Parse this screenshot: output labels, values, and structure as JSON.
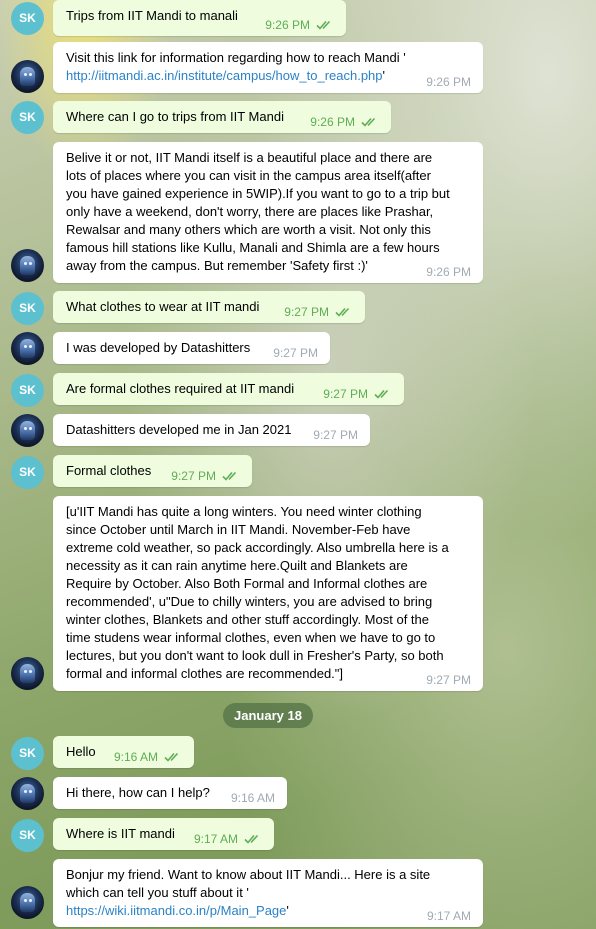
{
  "colors": {
    "outgoing_bubble": "#effdde",
    "incoming_bubble": "#ffffff",
    "outgoing_time": "#5fad56",
    "incoming_time": "#a1aab3",
    "link": "#2a82c8",
    "avatar_sk": "#5cc0cf"
  },
  "user_avatar_initials": "SK",
  "date_separator": "January 18",
  "messages": [
    {
      "from": "user",
      "text": "Trips from IIT Mandi to manali",
      "time": "9:26 PM",
      "read": true
    },
    {
      "from": "bot",
      "text": "Visit this link for  information regarding how to reach Mandi '",
      "link": "http://iitmandi.ac.in/institute/campus/how_to_reach.php",
      "after_link": "'",
      "time": "9:26 PM"
    },
    {
      "from": "user",
      "text": "Where can I go to trips from IIT Mandi",
      "time": "9:26 PM",
      "read": true
    },
    {
      "from": "bot",
      "lines": [
        "Belive it or not, IIT Mandi itself is a beautiful place and there are",
        "lots of places where you can visit in the campus area itself(after",
        "you have gained experience in 5WIP).If you want to go to a trip but",
        "only have a weekend, don't worry, there are places like Prashar,",
        "Rewalsar and many others which are worth a visit. Not only this",
        "famous hill stations like Kullu, Manali and Shimla are a few hours",
        "away from the campus. But remember 'Safety first :)'"
      ],
      "time": "9:26 PM"
    },
    {
      "from": "user",
      "text": "What clothes to wear at IIT mandi",
      "time": "9:27 PM",
      "read": true
    },
    {
      "from": "bot",
      "text": "I was developed by Datashitters",
      "time": "9:27 PM"
    },
    {
      "from": "user",
      "text": "Are formal clothes required at IIT mandi",
      "time": "9:27 PM",
      "read": true
    },
    {
      "from": "bot",
      "text": "Datashitters developed me in Jan 2021",
      "time": "9:27 PM"
    },
    {
      "from": "user",
      "text": "Formal clothes",
      "time": "9:27 PM",
      "read": true
    },
    {
      "from": "bot",
      "lines": [
        "[u'IIT Mandi has quite a long winters. You need winter clothing",
        "since October until March in IIT Mandi. November-Feb have",
        "extreme cold weather, so pack accordingly. Also umbrella here is a",
        "necessity as it can rain anytime here.Quilt and Blankets are",
        "Require by October. Also Both Formal and Informal clothes are",
        "recommended', u\"Due to chilly winters, you are advised to bring",
        "winter clothes, Blankets and other stuff accordingly. Most of the",
        "time studens wear informal clothes, even when we have to go to",
        "lectures, but you don't want to look dull in Fresher's Party, so both",
        "formal and informal clothes are recommended.\"]"
      ],
      "time": "9:27 PM"
    },
    {
      "from": "user",
      "text": "Hello",
      "time": "9:16 AM",
      "read": true
    },
    {
      "from": "bot",
      "text": "Hi there, how can I help?",
      "time": "9:16 AM"
    },
    {
      "from": "user",
      "text": "Where is IIT mandi",
      "time": "9:17 AM",
      "read": true
    },
    {
      "from": "bot",
      "lines": [
        "Bonjur my friend. Want to know about IIT Mandi... Here is a site",
        "which can tell you stuff about it '"
      ],
      "link": "https://wiki.iitmandi.co.in/p/Main_Page",
      "after_link": "'",
      "time": "9:17 AM"
    }
  ]
}
